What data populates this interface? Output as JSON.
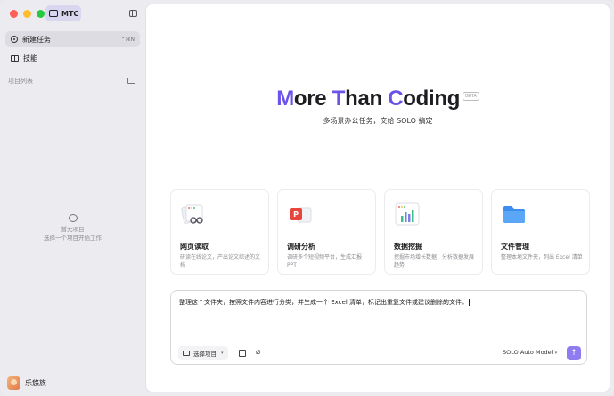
{
  "app": {
    "name": "MTC"
  },
  "sidebar": {
    "items": [
      {
        "label": "新建任务",
        "shortcut": "⌃⌘N",
        "active": true
      },
      {
        "label": "技能",
        "active": false
      }
    ],
    "section_label": "项目列表",
    "empty_title": "暂无项目",
    "empty_desc": "选择一个项目开始工作",
    "user_name": "乐悠族"
  },
  "hero": {
    "title_parts": [
      "M",
      "ore ",
      "T",
      "han ",
      "C",
      "oding"
    ],
    "badge": "BETA",
    "subtitle": "多场景办公任务，交给 SOLO 搞定"
  },
  "cards": [
    {
      "title": "网页读取",
      "desc": "研读在线论文，产出论文综述的文档",
      "icon": "web-reader-icon"
    },
    {
      "title": "调研分析",
      "desc": "调研多个短视频平台，生成汇报 PPT",
      "icon": "ppt-icon"
    },
    {
      "title": "数据挖掘",
      "desc": "挖掘市场增长数据，分析数据发展趋势",
      "icon": "bar-chart-icon"
    },
    {
      "title": "文件管理",
      "desc": "整理本地文件夹，列出 Excel 清单",
      "icon": "folder-icon"
    }
  ],
  "composer": {
    "text": "整理这个文件夹，按照文件内容进行分类，并生成一个 Excel 清单，标记出重复文件或建议删除的文件。",
    "project_button": "选择项目",
    "model": "SOLO Auto Model"
  },
  "colors": {
    "accent": "#6b52e8",
    "send": "#8f7cf0"
  }
}
